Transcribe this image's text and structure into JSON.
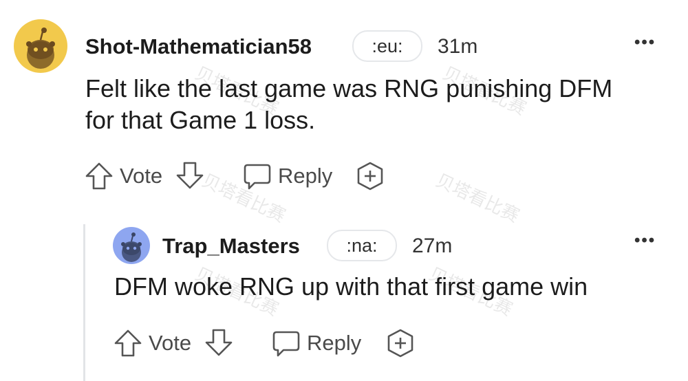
{
  "comments": [
    {
      "username": "Shot-Mathematician58",
      "flair": ":eu:",
      "time": "31m",
      "body_lines": [
        "Felt like the last game was RNG punishing DFM",
        "for that Game 1 loss."
      ],
      "vote_label": "Vote",
      "reply_label": "Reply",
      "avatar_color": "#f2c94c"
    },
    {
      "username": "Trap_Masters",
      "flair": ":na:",
      "time": "27m",
      "body_lines": [
        "DFM woke RNG up with that first game win"
      ],
      "vote_label": "Vote",
      "reply_label": "Reply",
      "avatar_color": "#8ea6f0"
    }
  ],
  "more_label": "•••",
  "watermark": "贝塔看比赛"
}
